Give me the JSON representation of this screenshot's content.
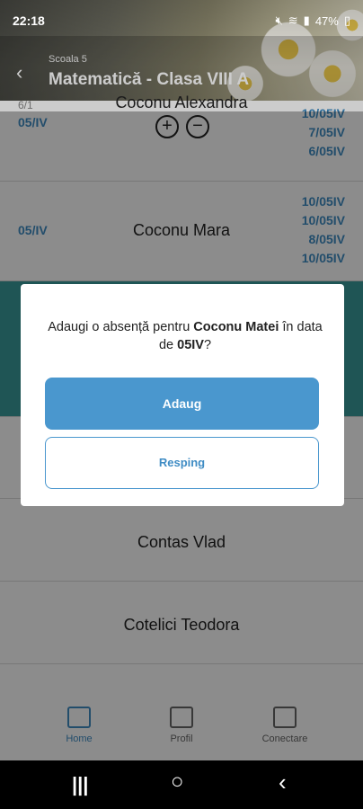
{
  "status": {
    "time": "22:18",
    "battery": "47%",
    "icons": [
      "mute-icon",
      "wifi-icon",
      "signal-icon",
      "battery-icon"
    ]
  },
  "header": {
    "back": "‹",
    "school": "Scoala 5",
    "title": "Matematică - Clasa VIII A"
  },
  "students": [
    {
      "name": "Coconu Alexandra",
      "left": "05/IV",
      "left_small": "6/1",
      "dates": [
        "10/05IV",
        "7/05IV",
        "6/05IV"
      ]
    },
    {
      "name": "Coconu Mara",
      "left": "05/IV",
      "dates": [
        "10/05IV",
        "10/05IV",
        "8/05IV",
        "10/05IV"
      ]
    },
    {
      "name": "Contas Vlad"
    },
    {
      "name": "Cotelici Teodora"
    }
  ],
  "buttons": {
    "plus": "+",
    "minus": "−"
  },
  "dialog": {
    "prefix": "Adaugi o absență pentru ",
    "student": "Coconu Matei",
    "mid": " în data de ",
    "date": "05IV",
    "suffix": "?",
    "add": "Adaug",
    "reject": "Resping"
  },
  "nav": [
    {
      "label": "Home",
      "active": true
    },
    {
      "label": "Profil"
    },
    {
      "label": "Conectare"
    }
  ],
  "sysnav": {
    "recent": "|||",
    "home": "○",
    "back": "‹"
  },
  "colors": {
    "accent": "#4a97ce",
    "teal": "#3a9b9c",
    "link": "#3f8cc4"
  }
}
